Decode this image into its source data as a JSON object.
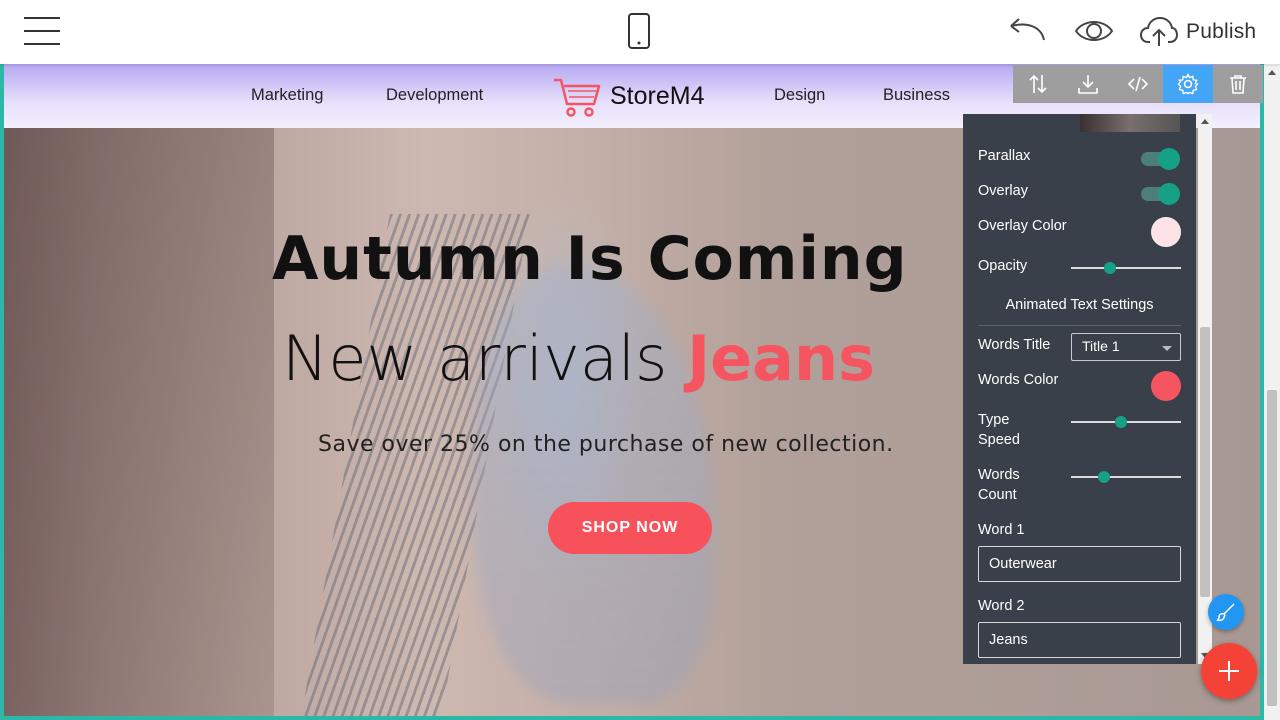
{
  "editor": {
    "publish_label": "Publish",
    "icons": [
      "menu-icon",
      "mobile-device-icon",
      "undo-icon",
      "preview-eye-icon",
      "cloud-upload-icon"
    ]
  },
  "site_nav": {
    "links": [
      "Marketing",
      "Development",
      "Design",
      "Business"
    ],
    "brand": "StoreM4",
    "brand_color": "#f55560"
  },
  "hero": {
    "title": "Autumn Is Coming",
    "subtitle_prefix": "New arrivals ",
    "subtitle_accent": "Jeans",
    "accent_color": "#f55560",
    "description": "Save over 25% on the purchase of new collection.",
    "cta_label": "SHOP NOW"
  },
  "block_toolbar": {
    "icons": [
      "reorder-icon",
      "download-icon",
      "code-icon",
      "gear-icon",
      "trash-icon"
    ],
    "active": "gear-icon"
  },
  "settings": {
    "parallax_label": "Parallax",
    "parallax_on": true,
    "overlay_label": "Overlay",
    "overlay_on": true,
    "overlay_color_label": "Overlay Color",
    "overlay_color": "#fde3e6",
    "opacity_label": "Opacity",
    "opacity_value": 0.35,
    "section_title": "Animated Text Settings",
    "words_title_label": "Words Title",
    "words_title_value": "Title 1",
    "words_color_label": "Words Color",
    "words_color": "#f55560",
    "type_speed_label_1": "Type",
    "type_speed_label_2": "Speed",
    "type_speed_value": 0.45,
    "words_count_label_1": "Words",
    "words_count_label_2": "Count",
    "words_count_value": 0.3,
    "word1_label": "Word 1",
    "word1_value": "Outerwear",
    "word2_label": "Word 2",
    "word2_value": "Jeans"
  }
}
